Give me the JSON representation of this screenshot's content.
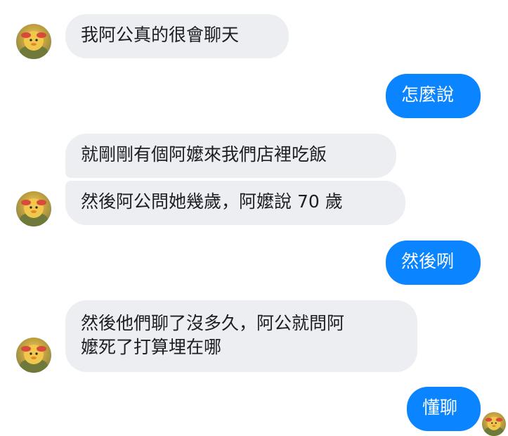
{
  "conversation": {
    "messages": [
      {
        "sender": "other",
        "text": "我阿公真的很會聊天"
      },
      {
        "sender": "me",
        "text": "怎麼說"
      },
      {
        "sender": "other",
        "text": "就剛剛有個阿嬤來我們店裡吃飯"
      },
      {
        "sender": "other",
        "text": "然後阿公問她幾歲，阿嬤說 70 歲"
      },
      {
        "sender": "me",
        "text": "然後咧"
      },
      {
        "sender": "other",
        "lines": [
          "然後他們聊了沒多久，阿公就問阿",
          "嬤死了打算埋在哪"
        ]
      },
      {
        "sender": "me",
        "text": "懂聊"
      }
    ]
  },
  "colors": {
    "incoming_bubble": "#eceef1",
    "outgoing_bubble": "#0a84ff",
    "incoming_text": "#1c1e21",
    "outgoing_text": "#ffffff"
  },
  "icons": {
    "contact_avatar": "duck-avatar-icon",
    "read_receipt": "duck-avatar-icon"
  }
}
